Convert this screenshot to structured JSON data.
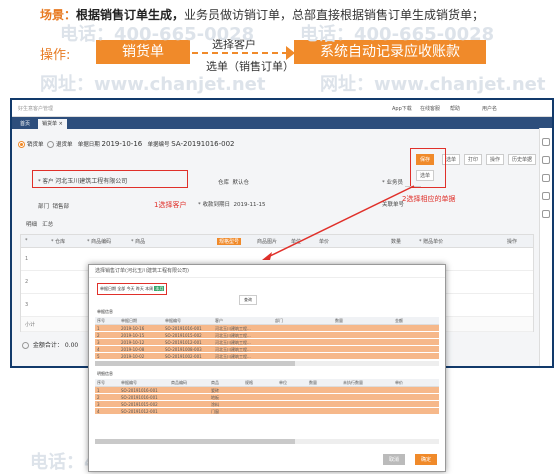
{
  "scene": {
    "label": "场景：",
    "bold": "根据销售订单生成，",
    "text": "业务员做访销订单，总部直接根据销售订单生成销货单；"
  },
  "ops": {
    "label": "操作:",
    "step1": "销货单",
    "arrow_top": "选择客户",
    "arrow_bottom": "选单（销售订单）",
    "step2": "系统自动记录应收账款"
  },
  "watermarks": [
    "电话：400-665-0028",
    "网址：www.chanjet.net"
  ],
  "app": {
    "title": "好生意客户管理",
    "topbar_items": [
      "App下载",
      "在线客服",
      "帮助",
      "用户名"
    ],
    "tabs": [
      "首页",
      "销货单 ×"
    ],
    "bill_type_selected": "销货单",
    "bill_type_other": "退货单",
    "date_label": "单据日期",
    "date_value": "2019-10-16",
    "no_label": "单据编号",
    "no_value": "SA-20191016-002",
    "customer_label": "* 客户",
    "customer_value": "河北玉川建筑工程有限公司",
    "warehouse_label": "仓库",
    "warehouse_value": "默认仓",
    "salesperson_label": "* 业务员",
    "dept_label": "部门",
    "dept_value": "销售部",
    "due_label": "* 收款到期日",
    "due_value": "2019-11-15",
    "related_label": "关联单号",
    "tabs_detail": [
      "明细",
      "汇总"
    ],
    "toolbar": [
      "保存",
      "选单",
      "打印",
      "操作",
      "历史单据"
    ],
    "choose_menu": "选单",
    "annotation1": "1选择客户",
    "annotation2": "2选择相应的单据",
    "grid_headers": [
      "*",
      "* 仓库",
      "* 商品编码",
      "* 商品",
      "规格型号",
      "商品图片",
      "单位",
      "单价",
      "数量",
      "* 赠品单价",
      "操作"
    ],
    "grid_rows": [
      "1",
      "2",
      "3"
    ],
    "total_row": "小计",
    "sum_label": "金额合计：",
    "sum_value": "0.00"
  },
  "popup": {
    "title": "选择销售订单(河北玉川建筑工程有限公司)",
    "filter_label": "单据日期",
    "filter_tags": [
      "全部",
      "今天",
      "昨天",
      "本周",
      "本月"
    ],
    "filter_active": "本月",
    "search_btn": "查询",
    "orders_label": "单据信息",
    "orders_headers": [
      "序号",
      "单据日期",
      "单据编号",
      "客户",
      "部门",
      "数量",
      "金额"
    ],
    "orders": [
      {
        "no": "1",
        "date": "2019-10-16",
        "code": "SO-20191016-001",
        "customer": "河北玉川建筑工程..."
      },
      {
        "no": "2",
        "date": "2019-10-15",
        "code": "SO-20191015-002",
        "customer": "河北玉川建筑工程..."
      },
      {
        "no": "3",
        "date": "2019-10-12",
        "code": "SO-20191012-001",
        "customer": "河北玉川建筑工程..."
      },
      {
        "no": "4",
        "date": "2019-10-08",
        "code": "SO-20191008-003",
        "customer": "河北玉川建筑工程..."
      },
      {
        "no": "5",
        "date": "2019-10-02",
        "code": "SO-20191002-001",
        "customer": "河北玉川建筑工程..."
      }
    ],
    "detail_label": "明细信息",
    "detail_headers": [
      "序号",
      "单据编号",
      "商品编码",
      "商品",
      "规格",
      "单位",
      "数量",
      "未执行数量",
      "单价"
    ],
    "details": [
      {
        "no": "1",
        "code": "SO-20191016-001",
        "item": "瓷砖"
      },
      {
        "no": "2",
        "code": "SO-20191016-001",
        "item": "地板"
      },
      {
        "no": "3",
        "code": "SO-20191015-002",
        "item": "涂料"
      },
      {
        "no": "4",
        "code": "SO-20191012-001",
        "item": "门窗"
      }
    ],
    "cancel": "取消",
    "confirm": "确定"
  }
}
